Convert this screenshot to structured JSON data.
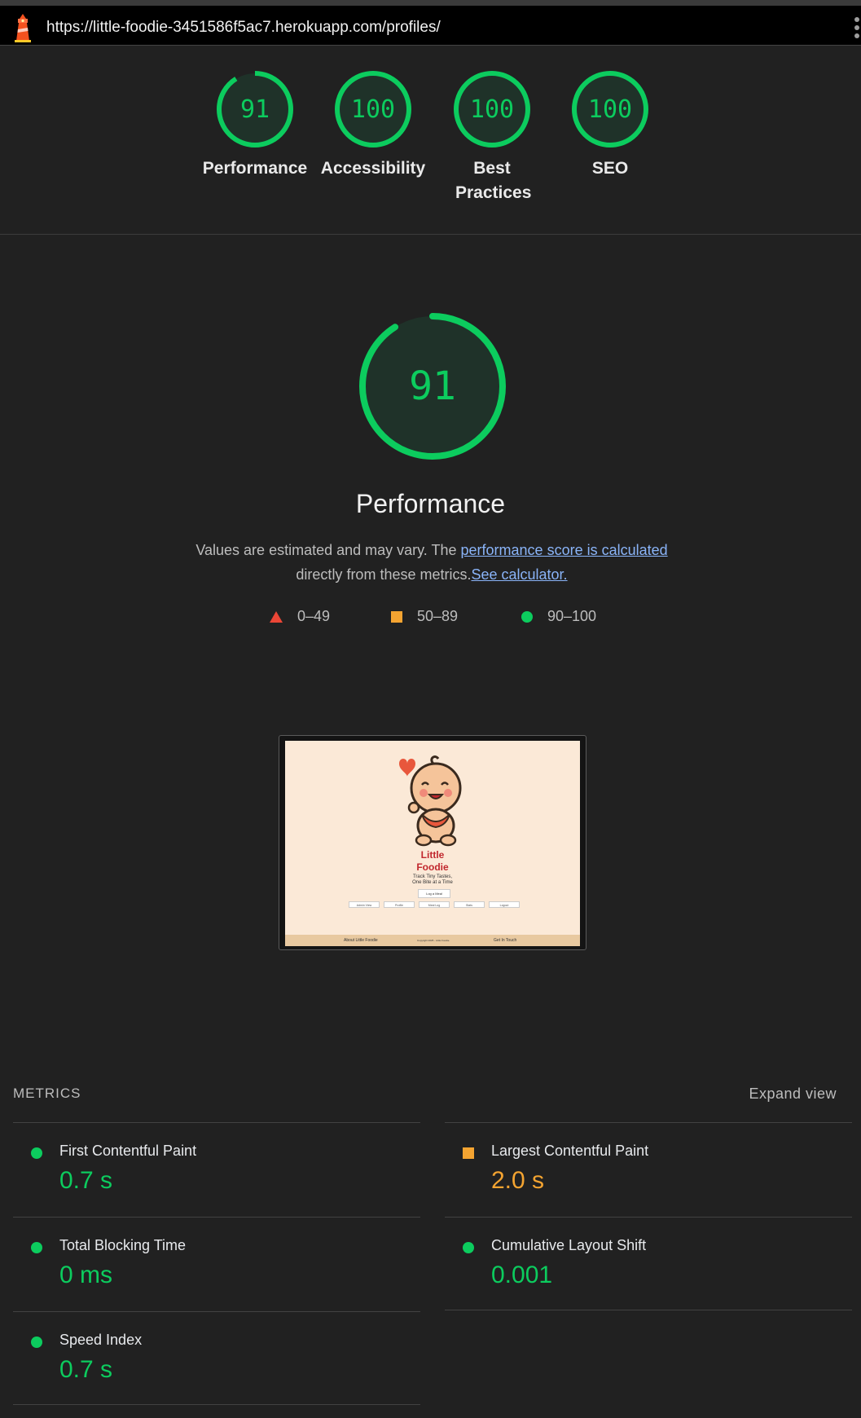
{
  "browser": {
    "url": "https://little-foodie-3451586f5ac7.herokuapp.com/profiles/",
    "logo_icon": "lighthouse-icon",
    "menu_icon": "kebab-menu-icon"
  },
  "summary_gauges": [
    {
      "score": "91",
      "label": "Performance"
    },
    {
      "score": "100",
      "label": "Accessibility"
    },
    {
      "score": "100",
      "label": "Best Practices"
    },
    {
      "score": "100",
      "label": "SEO"
    }
  ],
  "summary_scores_numeric": [
    91,
    100,
    100,
    100
  ],
  "performance": {
    "score": "91",
    "score_numeric": 91,
    "title": "Performance",
    "desc_prefix": "Values are estimated and may vary. The ",
    "desc_link1": "performance score is calculated",
    "desc_middle": " directly from these metrics.",
    "desc_link2": "See calculator."
  },
  "legend": {
    "fail": "0–49",
    "average": "50–89",
    "pass": "90–100"
  },
  "colors": {
    "pass": "#0ccc5e",
    "average": "#f4a431",
    "fail": "#eb4636",
    "link": "#8ab4f8"
  },
  "screenshot": {
    "title_line1": "Little",
    "title_line2": "Foodie",
    "subtitle_line1": "Track Tiny Tastes,",
    "subtitle_line2": "One Bite at a Time",
    "button": "Log a Meal",
    "nav": [
      "Admin View",
      "Profile",
      "Meal Log",
      "Stats",
      "Logout"
    ],
    "footer_left": "About Little Foodie",
    "footer_center": "Copyright 2025 - Little Foodie",
    "footer_right": "Get In Touch",
    "mascot_icon": "baby-mascot-icon",
    "heart_icon": "heart-icon"
  },
  "metrics": {
    "heading": "METRICS",
    "expand_label": "Expand view",
    "items": [
      {
        "name": "First Contentful Paint",
        "value": "0.7 s",
        "rating": "pass"
      },
      {
        "name": "Largest Contentful Paint",
        "value": "2.0 s",
        "rating": "average"
      },
      {
        "name": "Total Blocking Time",
        "value": "0 ms",
        "rating": "pass"
      },
      {
        "name": "Cumulative Layout Shift",
        "value": "0.001",
        "rating": "pass"
      },
      {
        "name": "Speed Index",
        "value": "0.7 s",
        "rating": "pass"
      }
    ]
  }
}
